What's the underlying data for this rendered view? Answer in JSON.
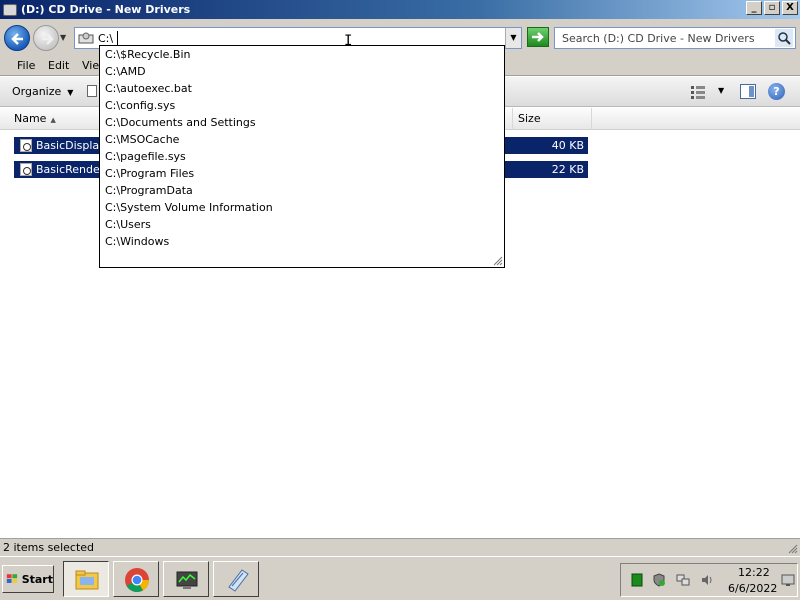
{
  "window": {
    "title": "(D:) CD Drive - New Drivers",
    "minimize_glyph": "_",
    "maximize_glyph": "▫",
    "close_glyph": "X"
  },
  "nav": {
    "address_value": "C:\\",
    "search_placeholder": "Search (D:) CD Drive - New Drivers"
  },
  "menu": {
    "items": [
      {
        "label": "File"
      },
      {
        "label": "Edit"
      },
      {
        "label": "View"
      }
    ]
  },
  "toolbar": {
    "organize_label": "Organize",
    "help_glyph": "?"
  },
  "columns": {
    "name": "Name",
    "size": "Size"
  },
  "files": [
    {
      "name": "BasicDisplay.",
      "size": "40 KB"
    },
    {
      "name": "BasicRender.",
      "size": "22 KB"
    }
  ],
  "autocomplete": {
    "items": [
      "C:\\$Recycle.Bin",
      "C:\\AMD",
      "C:\\autoexec.bat",
      "C:\\config.sys",
      "C:\\Documents and Settings",
      "C:\\MSOCache",
      "C:\\pagefile.sys",
      "C:\\Program Files",
      "C:\\ProgramData",
      "C:\\System Volume Information",
      "C:\\Users",
      "C:\\Windows"
    ]
  },
  "status": {
    "text": "2 items selected"
  },
  "taskbar": {
    "start_label": "Start",
    "apps": [
      "file-explorer-icon",
      "chrome-icon",
      "device-manager-icon",
      "notepad-icon"
    ],
    "time": "12:22",
    "date": "6/6/2022"
  },
  "colors": {
    "selection": "#0a246a",
    "window_face": "#d4d0c8",
    "title_start": "#0a246a"
  }
}
